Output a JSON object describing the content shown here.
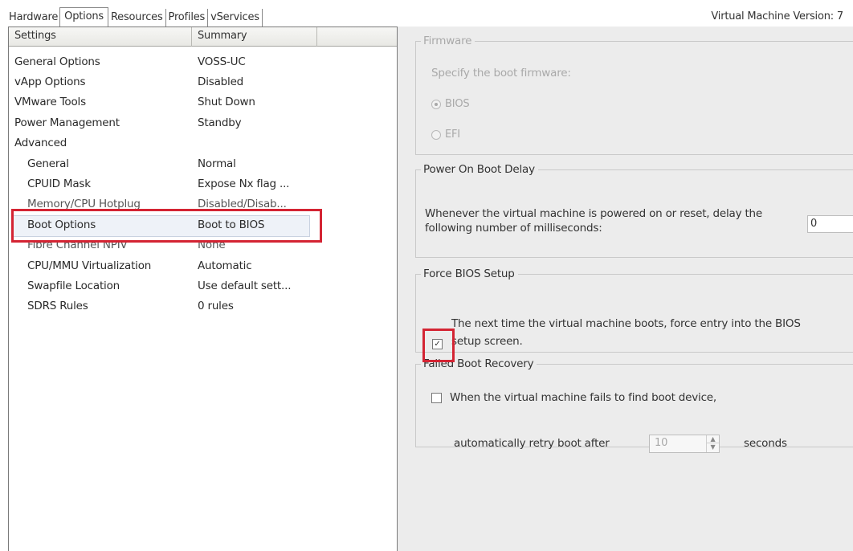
{
  "tabs": [
    {
      "label": "Hardware"
    },
    {
      "label": "Options"
    },
    {
      "label": "Resources"
    },
    {
      "label": "Profiles"
    },
    {
      "label": "vServices"
    }
  ],
  "vm_version": {
    "label": "Virtual Machine Version:",
    "value": "7"
  },
  "columns": {
    "settings": "Settings",
    "summary": "Summary"
  },
  "rows": [
    {
      "name": "General Options",
      "summary": "VOSS-UC"
    },
    {
      "name": "vApp Options",
      "summary": "Disabled"
    },
    {
      "name": "VMware Tools",
      "summary": "Shut Down"
    },
    {
      "name": "Power Management",
      "summary": "Standby"
    },
    {
      "name": "Advanced",
      "summary": ""
    },
    {
      "name": "General",
      "summary": "Normal"
    },
    {
      "name": "CPUID Mask",
      "summary": "Expose Nx flag ..."
    },
    {
      "name": "Memory/CPU Hotplug",
      "summary": "Disabled/Disab..."
    },
    {
      "name": "Boot Options",
      "summary": "Boot to BIOS"
    },
    {
      "name": "Fibre Channel NPIV",
      "summary": "None"
    },
    {
      "name": "CPU/MMU Virtualization",
      "summary": "Automatic"
    },
    {
      "name": "Swapfile Location",
      "summary": "Use default sett..."
    },
    {
      "name": "SDRS Rules",
      "summary": "0 rules"
    }
  ],
  "firmware": {
    "legend": "Firmware",
    "prompt": "Specify the boot firmware:",
    "options": [
      {
        "label": "BIOS",
        "selected": true
      },
      {
        "label": "EFI",
        "selected": false
      }
    ]
  },
  "boot_delay": {
    "legend": "Power On Boot Delay",
    "line1": "Whenever the virtual machine is powered on or reset, delay the",
    "line2": "following number of milliseconds:",
    "value": "0"
  },
  "bios_setup": {
    "legend": "Force BIOS Setup",
    "checked": true,
    "line1": "The next time the virtual machine boots, force entry into the BIOS",
    "line2": "setup screen."
  },
  "failed_recovery": {
    "legend": "Failed Boot Recovery",
    "checkbox_label": "When the virtual machine fails to find boot device,",
    "checked": false,
    "retry_label": "automatically retry boot after",
    "retry_value": "10",
    "unit": "seconds"
  },
  "colors": {
    "highlight": "#d42433",
    "pane_bg": "#ececec",
    "disabled_text": "#a9a9a9"
  }
}
